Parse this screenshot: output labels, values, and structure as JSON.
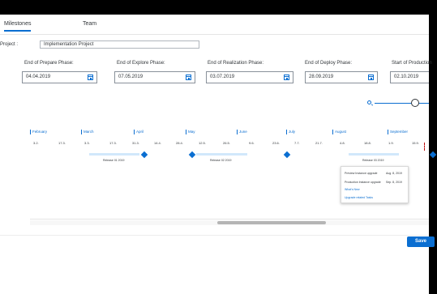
{
  "tabs": [
    {
      "label": "Milestones",
      "active": true
    },
    {
      "label": "Team",
      "active": false
    }
  ],
  "project": {
    "label": "Project :",
    "value": "Implementation Project"
  },
  "phases": [
    {
      "label": "End of Prepare Phase:",
      "value": "04.04.2019"
    },
    {
      "label": "End of Explore Phase:",
      "value": "07.05.2019"
    },
    {
      "label": "End of Realization Phase:",
      "value": "03.07.2019"
    },
    {
      "label": "End of Deploy Phase:",
      "value": "28.09.2019"
    },
    {
      "label": "Start of Production",
      "value": "02.10.2019"
    }
  ],
  "zoom_level": 0.75,
  "timeline": {
    "months": [
      "February",
      "March",
      "April",
      "May",
      "June",
      "July",
      "August",
      "September"
    ],
    "ticks": [
      "3.2.",
      "17.3.",
      "3.3.",
      "17.3.",
      "31.3.",
      "14.4.",
      "28.4.",
      "12.5.",
      "26.5.",
      "9.6.",
      "23.6.",
      "7.7.",
      "21.7.",
      "4.8.",
      "18.8.",
      "1.9.",
      "15.9."
    ],
    "releases": [
      {
        "label": "Release 01 2019"
      },
      {
        "label": "Release 02 2019"
      },
      {
        "label": "Release 03 2019"
      }
    ]
  },
  "popover": {
    "rows": [
      {
        "label": "Preview Instance upgrade",
        "date": "Aug. 8, 2019"
      },
      {
        "label": "Production Instance upgrade",
        "date": "Sep. 8, 2019"
      }
    ],
    "whats_new": "What's New",
    "upgrade_tasks": "Upgrade related Tasks"
  },
  "footer": {
    "save_label": "Save"
  },
  "colors": {
    "accent": "#0a6ed1",
    "today_line": "#bb0000"
  }
}
